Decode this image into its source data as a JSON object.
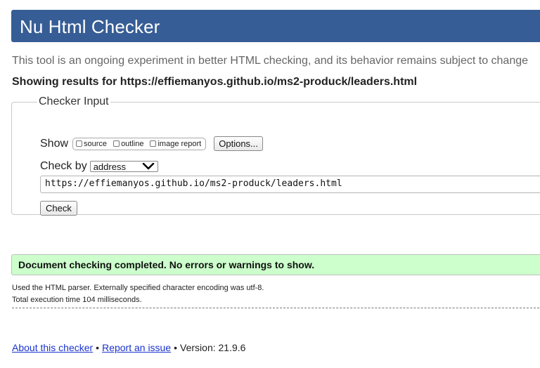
{
  "header": {
    "title": "Nu Html Checker"
  },
  "tagline": "This tool is an ongoing experiment in better HTML checking, and its behavior remains subject to change",
  "showing_results": "Showing results for https://effiemanyos.github.io/ms2-produck/leaders.html",
  "checker_input": {
    "legend": "Checker Input",
    "show_label": "Show",
    "show_options": [
      {
        "label": "source",
        "checked": false
      },
      {
        "label": "outline",
        "checked": false
      },
      {
        "label": "image report",
        "checked": false
      }
    ],
    "options_button": "Options...",
    "check_by_label": "Check by",
    "check_by_value": "address",
    "url_value": "https://effiemanyos.github.io/ms2-produck/leaders.html",
    "check_button": "Check"
  },
  "result": {
    "message": "Document checking completed. No errors or warnings to show.",
    "color": "#ccffcc"
  },
  "details": {
    "parser": "Used the HTML parser. Externally specified character encoding was utf-8.",
    "time": "Total execution time 104 milliseconds."
  },
  "footer": {
    "about_link": "About this checker",
    "separator": "•",
    "report_link": "Report an issue",
    "version": "Version: 21.9.6"
  },
  "colors": {
    "header_bg": "#365d95",
    "link": "#1a33cc"
  }
}
